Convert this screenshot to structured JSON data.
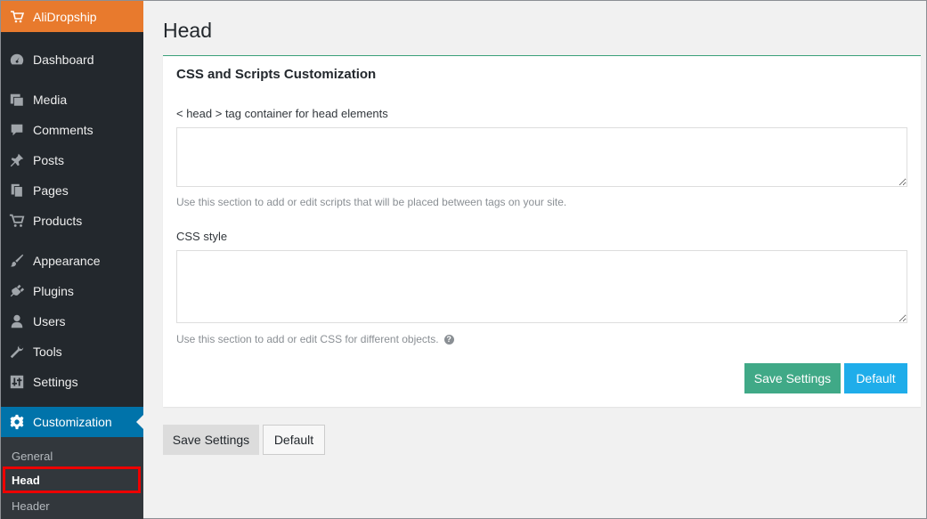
{
  "sidebar": {
    "brand": "AliDropship",
    "items": [
      {
        "label": "Dashboard",
        "icon": "dashboard-icon"
      },
      {
        "label": "Media",
        "icon": "media-icon"
      },
      {
        "label": "Comments",
        "icon": "comments-icon"
      },
      {
        "label": "Posts",
        "icon": "pin-icon"
      },
      {
        "label": "Pages",
        "icon": "pages-icon"
      },
      {
        "label": "Products",
        "icon": "cart-icon"
      },
      {
        "label": "Appearance",
        "icon": "brush-icon"
      },
      {
        "label": "Plugins",
        "icon": "plug-icon"
      },
      {
        "label": "Users",
        "icon": "user-icon"
      },
      {
        "label": "Tools",
        "icon": "wrench-icon"
      },
      {
        "label": "Settings",
        "icon": "sliders-icon"
      },
      {
        "label": "Customization",
        "icon": "gear-icon"
      }
    ],
    "submenu": [
      "General",
      "Head",
      "Header"
    ]
  },
  "main": {
    "title": "Head",
    "panel": {
      "title": "CSS and Scripts Customization",
      "head_label": "< head > tag container for head elements",
      "head_value": "",
      "head_help": "Use this section to add or edit scripts that will be placed between tags on your site.",
      "css_label": "CSS style",
      "css_value": "",
      "css_help": "Use this section to add or edit CSS for different objects.",
      "save_label": "Save Settings",
      "default_label": "Default"
    },
    "bottom": {
      "save_label": "Save Settings",
      "default_label": "Default"
    }
  },
  "colors": {
    "brand": "#e87a2d",
    "sidebar_bg": "#23282d",
    "active": "#0073aa",
    "save_green": "#40a987",
    "default_blue": "#1fadea"
  }
}
